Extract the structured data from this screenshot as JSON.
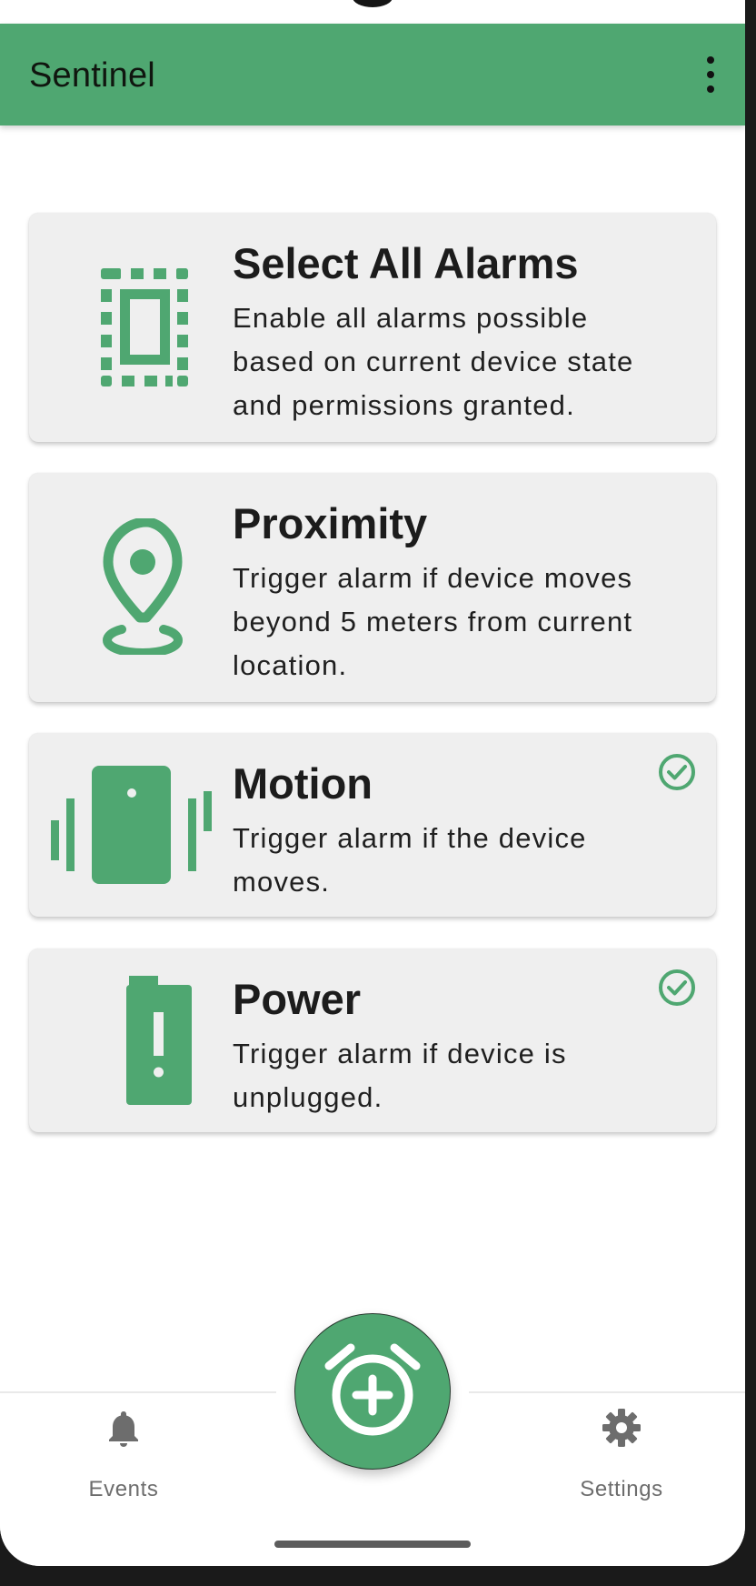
{
  "app_bar": {
    "title": "Sentinel",
    "menu_icon": "more-vert-icon"
  },
  "colors": {
    "accent": "#4fa771",
    "card_bg": "#efefef",
    "icon_gray": "#6d6d6d"
  },
  "alarms": [
    {
      "title": "Select All Alarms",
      "description": "Enable all alarms possible based on current device state and permissions granted.",
      "icon": "select-all-icon",
      "checked": false
    },
    {
      "title": "Proximity",
      "description": "Trigger alarm if device moves beyond 5 meters from current location.",
      "icon": "location-pin-icon",
      "checked": false
    },
    {
      "title": "Motion",
      "description": "Trigger alarm if the device moves.",
      "icon": "vibration-icon",
      "checked": true
    },
    {
      "title": "Power",
      "description": "Trigger alarm if device is unplugged.",
      "icon": "battery-alert-icon",
      "checked": true
    }
  ],
  "bottom_nav": {
    "events_label": "Events",
    "events_icon": "bell-icon",
    "settings_label": "Settings",
    "settings_icon": "gear-icon",
    "fab_icon": "alarm-add-icon"
  }
}
